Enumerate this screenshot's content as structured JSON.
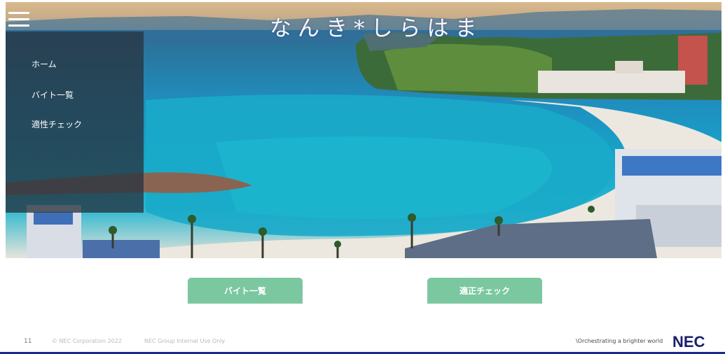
{
  "header": {
    "site_title": "なんき*しらはま"
  },
  "side_menu": {
    "items": [
      {
        "label": "ホーム"
      },
      {
        "label": "バイト一覧"
      },
      {
        "label": "適性チェック"
      }
    ]
  },
  "actions": {
    "job_list_label": "バイト一覧",
    "aptitude_check_label": "適正チェック"
  },
  "footer": {
    "page_number": "11",
    "copyright": "© NEC Corporation 2022",
    "classification": "NEC Group Internal Use Only",
    "tagline": "\\Orchestrating a brighter world",
    "logo": "NEC"
  },
  "colors": {
    "button": "#7bc8a0",
    "menu_overlay": "#283440",
    "brand_navy": "#1a1f6e"
  },
  "icons": [
    "menu-hamburger-icon"
  ]
}
